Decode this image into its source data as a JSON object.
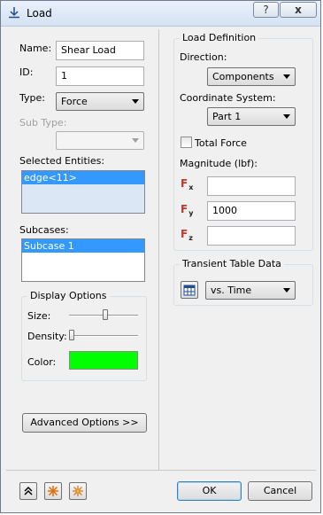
{
  "window": {
    "title": "Load",
    "help_label": "?",
    "close_label": "x"
  },
  "left": {
    "name_label": "Name:",
    "name_value": "Shear Load",
    "id_label": "ID:",
    "id_value": "1",
    "type_label": "Type:",
    "type_value": "Force",
    "subtype_label": "Sub Type:",
    "subtype_value": "",
    "selected_entities_label": "Selected Entities:",
    "selected_entities": [
      "edge<11>"
    ],
    "subcases_label": "Subcases:",
    "subcases": [
      "Subcase 1"
    ],
    "display_options": {
      "title": "Display Options",
      "size_label": "Size:",
      "density_label": "Density:",
      "color_label": "Color:",
      "color": "#00ff00",
      "size_level": 0.53,
      "density_level": 0.0
    },
    "advanced_button": "Advanced Options >>"
  },
  "right": {
    "load_definition": {
      "title": "Load Definition",
      "direction_label": "Direction:",
      "direction_value": "Components",
      "coord_label": "Coordinate System:",
      "coord_value": "Part 1",
      "total_force_label": "Total Force",
      "total_force_checked": false,
      "magnitude_label": "Magnitude (lbf):",
      "fx_letter": "F",
      "fx_sub": "x",
      "fx_value": "",
      "fy_letter": "F",
      "fy_sub": "y",
      "fy_value": "1000",
      "fz_letter": "F",
      "fz_sub": "z",
      "fz_value": ""
    },
    "transient": {
      "title": "Transient Table Data",
      "table_icon": "table-icon",
      "time_value": "vs. Time"
    }
  },
  "footer": {
    "ok_label": "OK",
    "cancel_label": "Cancel",
    "icons": [
      "collapse-icon",
      "burst-icon",
      "burst-grid-icon"
    ]
  }
}
